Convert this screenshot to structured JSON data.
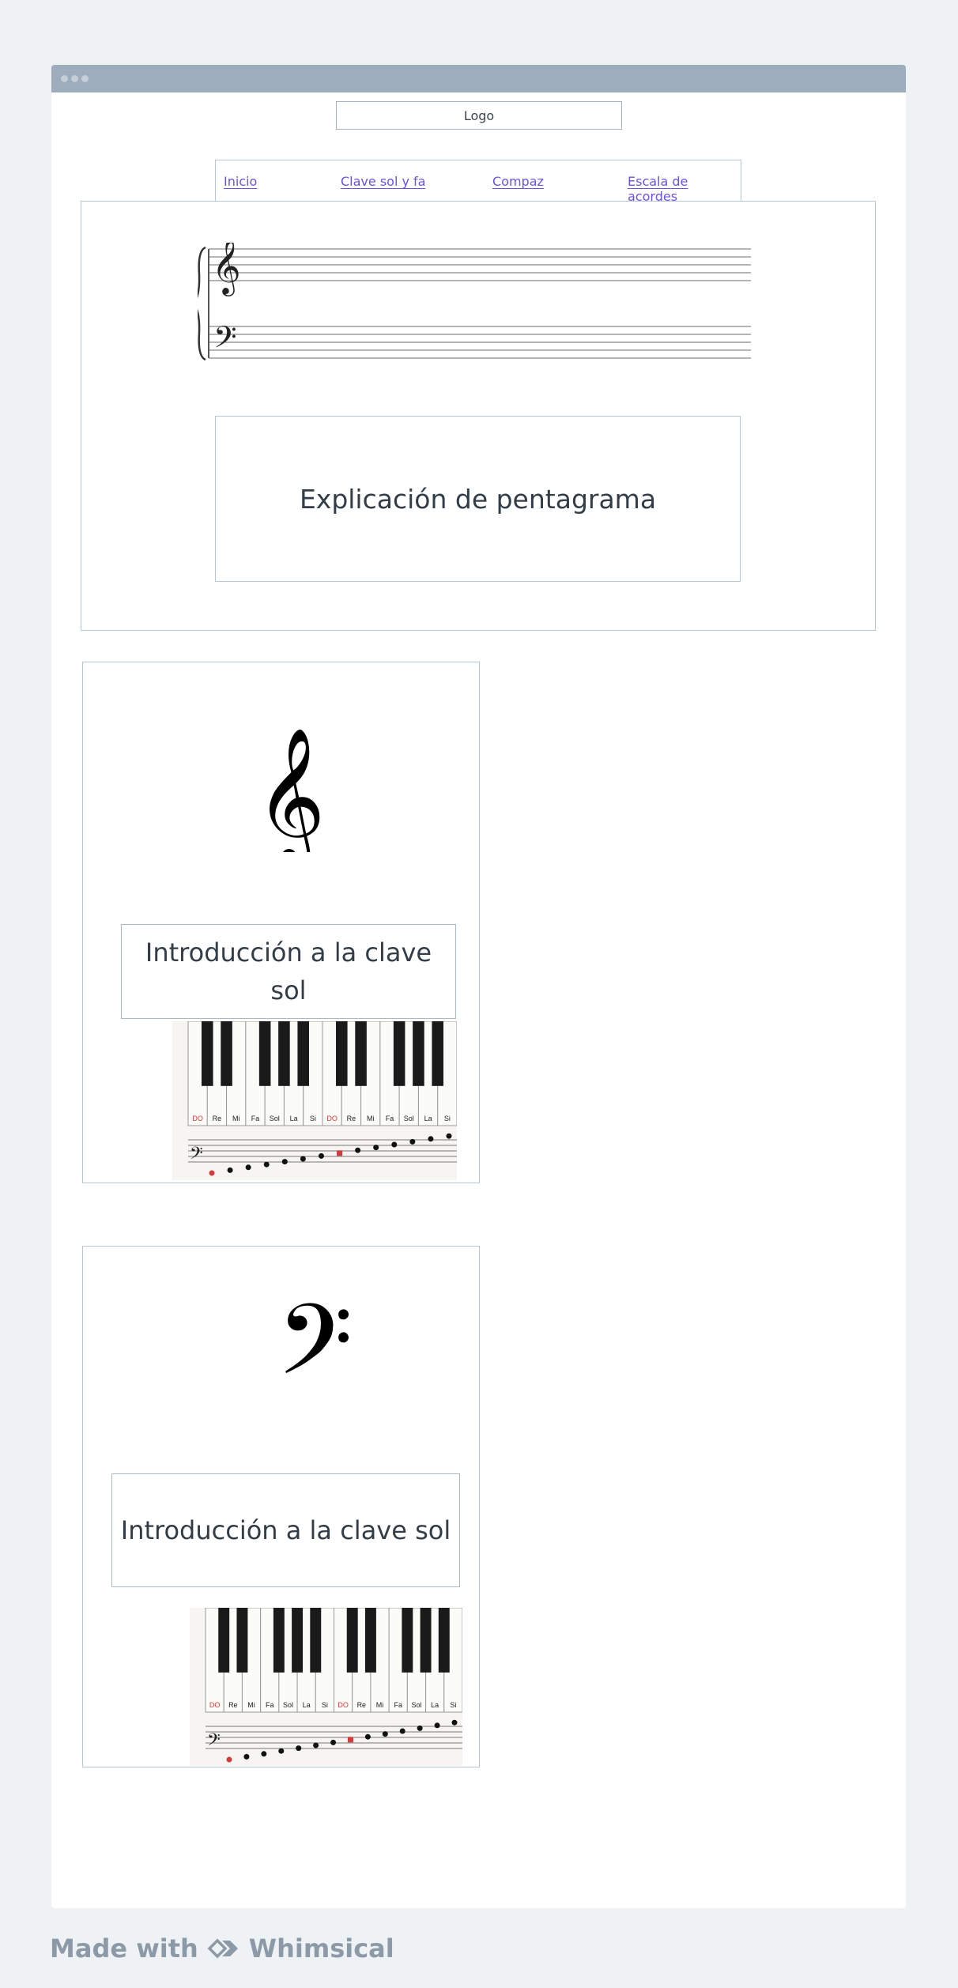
{
  "header": {
    "logo_label": "Logo"
  },
  "nav": {
    "items": [
      {
        "label": "Inicio"
      },
      {
        "label": "Clave sol y fa"
      },
      {
        "label": "Compaz"
      },
      {
        "label": "Escala de acordes"
      }
    ]
  },
  "staff_section": {
    "explanation": "Explicación de pentagrama"
  },
  "cards": [
    {
      "clef": "treble-clef",
      "title": "Introducción a la clave sol",
      "keyboard_labels": [
        "DO",
        "Re",
        "Mi",
        "Fa",
        "Sol",
        "La",
        "Si",
        "DO",
        "Re",
        "Mi",
        "Fa",
        "Sol",
        "La",
        "Si"
      ]
    },
    {
      "clef": "bass-clef",
      "title": "Introducción a la clave sol",
      "keyboard_labels": [
        "DO",
        "Re",
        "Mi",
        "Fa",
        "Sol",
        "La",
        "Si",
        "DO",
        "Re",
        "Mi",
        "Fa",
        "Sol",
        "La",
        "Si"
      ]
    }
  ],
  "footer": {
    "made_with": "Made with",
    "brand": "Whimsical"
  },
  "colors": {
    "accent_link": "#6b52e8",
    "border": "#b6c6d6",
    "titlebar": "#9dadbc",
    "red_note": "#d23b3b"
  }
}
